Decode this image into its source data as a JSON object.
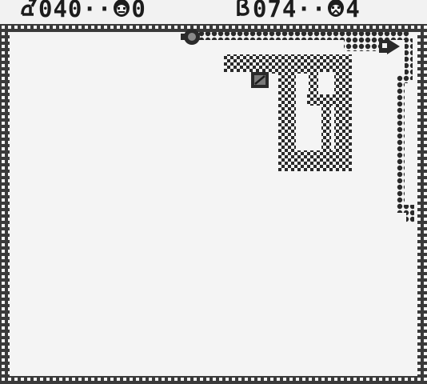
{
  "hud": {
    "player1": {
      "score": "040",
      "lives": "0",
      "lives_icon": "ghost-face-icon"
    },
    "player2": {
      "score": "074",
      "lives": "4",
      "lives_icon": "ghost-face-icon"
    },
    "separator": "··"
  },
  "palette": {
    "dark": "#2a2a2a",
    "mid": "#5a5a5a",
    "light": "#f4f4f4",
    "hud_bg": "#f2f2f2"
  },
  "game": {
    "mode": "light-cycle",
    "player2_heading": "right"
  }
}
